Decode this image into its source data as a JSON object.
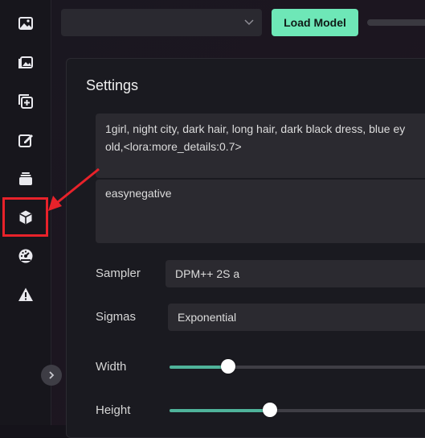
{
  "sidebar": {
    "items": [
      {
        "icon": "image-icon"
      },
      {
        "icon": "images-icon"
      },
      {
        "icon": "add-image-icon"
      },
      {
        "icon": "edit-icon"
      },
      {
        "icon": "layers-icon"
      },
      {
        "icon": "cube-icon"
      },
      {
        "icon": "gauge-icon"
      },
      {
        "icon": "warning-icon"
      }
    ],
    "collapse_icon": "chevron-right-icon"
  },
  "topbar": {
    "model_select_value": "",
    "load_model_label": "Load Model"
  },
  "settings": {
    "title": "Settings",
    "prompt": "1girl, night city, dark hair, long hair, dark black dress, blue ey\nold,<lora:more_details:0.7>",
    "negative_prompt": "easynegative",
    "sampler_label": "Sampler",
    "sampler_value": "DPM++ 2S a",
    "sigmas_label": "Sigmas",
    "sigmas_value": "Exponential",
    "width_label": "Width",
    "width_fraction": 0.22,
    "height_label": "Height",
    "height_fraction": 0.38
  },
  "colors": {
    "accent": "#6ee7b7",
    "slider_fill": "#4fb39a",
    "highlight": "#e8222a"
  }
}
